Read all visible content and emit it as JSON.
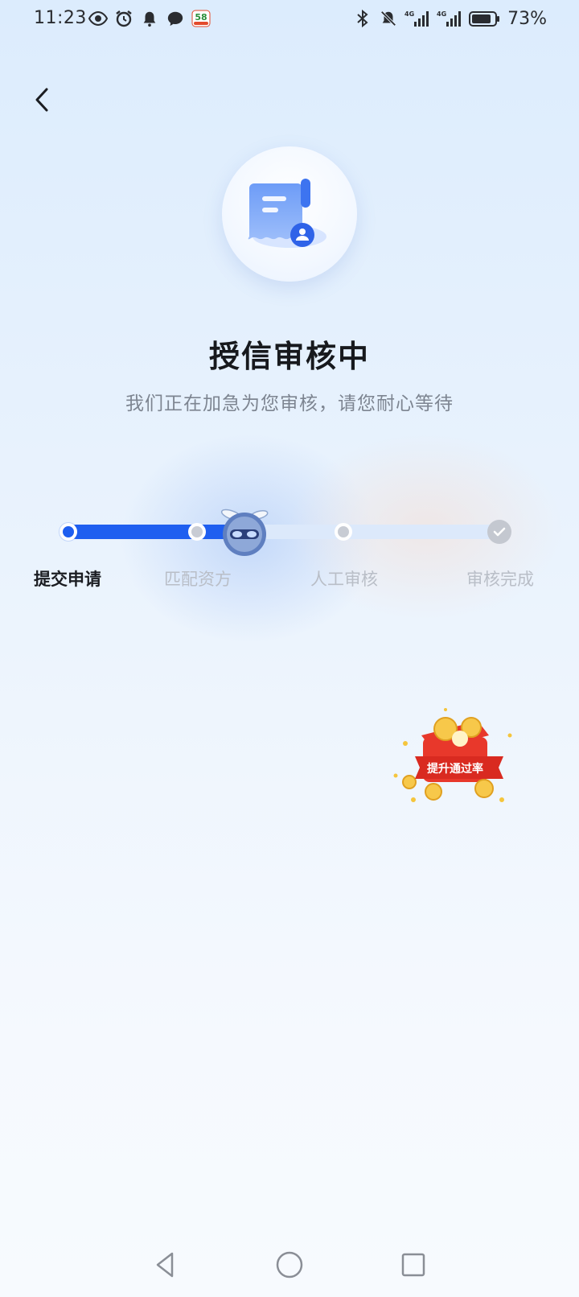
{
  "status_bar": {
    "time": "11:23",
    "badge_text": "58",
    "battery_text": "73%",
    "icons": [
      "eye-icon",
      "alarm-icon",
      "bell-icon",
      "message-icon",
      "58-app-icon",
      "bluetooth-icon",
      "mute-icon",
      "signal-4g-icon",
      "signal-4g-icon",
      "battery-icon"
    ],
    "signal_label": "4G"
  },
  "page": {
    "title": "授信审核中",
    "subtitle": "我们正在加急为您审核，请您耐心等待"
  },
  "progress": {
    "steps": [
      {
        "label": "提交申请",
        "state": "done"
      },
      {
        "label": "匹配资方",
        "state": "pending"
      },
      {
        "label": "人工审核",
        "state": "pending"
      },
      {
        "label": "审核完成",
        "state": "pending"
      }
    ],
    "current_fraction": 0.4
  },
  "promo": {
    "label": "提升通过率"
  },
  "colors": {
    "accent": "#1f5ff0",
    "track": "#dce9fb",
    "pending": "#c8ccd4"
  }
}
